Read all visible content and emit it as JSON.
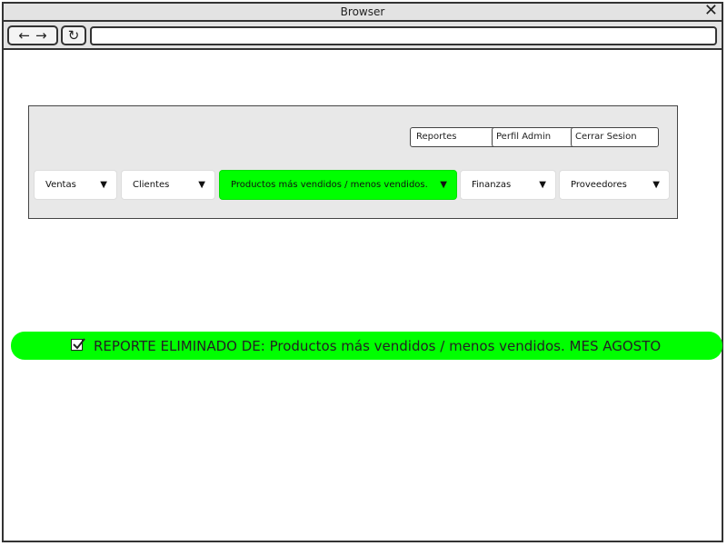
{
  "window": {
    "title": "Browser",
    "close_icon": "close-icon"
  },
  "toolbar": {
    "address": ""
  },
  "header_buttons": [
    {
      "label": "Reportes"
    },
    {
      "label": "Perfil Admin"
    },
    {
      "label": "Cerrar Sesion"
    }
  ],
  "menu": [
    {
      "label": "Ventas",
      "active": false
    },
    {
      "label": "Clientes",
      "active": false
    },
    {
      "label": "Productos más vendidos / menos vendidos.",
      "active": true
    },
    {
      "label": "Finanzas",
      "active": false
    },
    {
      "label": "Proveedores",
      "active": false
    }
  ],
  "alert": {
    "text": "REPORTE ELIMINADO DE: Productos más vendidos / menos vendidos. MES AGOSTO",
    "color": "#00ff00"
  },
  "colors": {
    "accent": "#00ff00",
    "panel": "#e8e8e8",
    "chrome": "#e3e3e3"
  }
}
